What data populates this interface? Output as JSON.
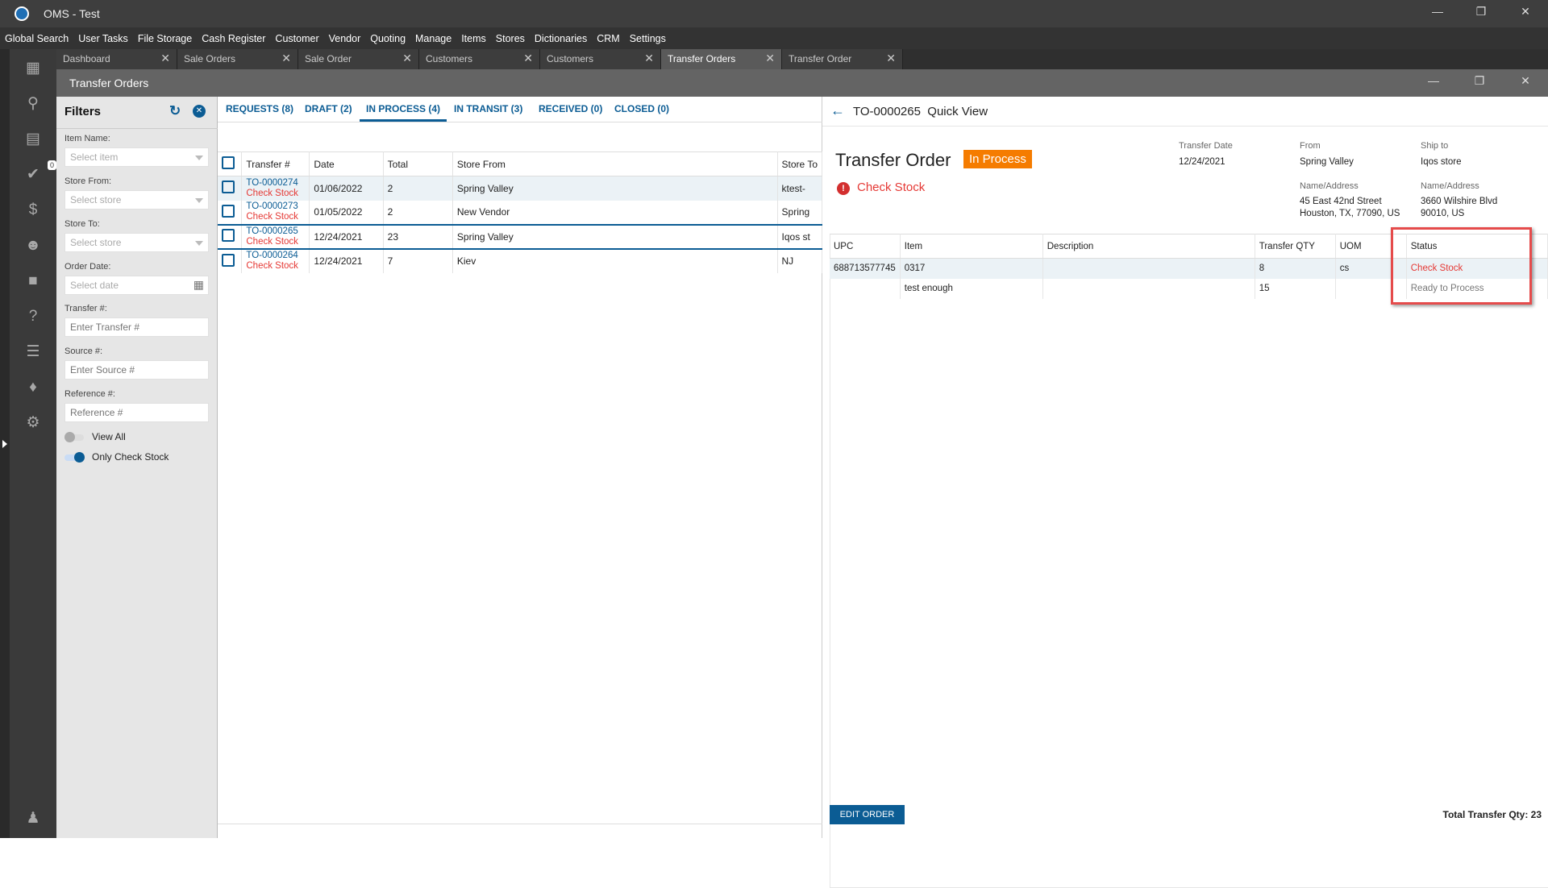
{
  "app": {
    "title": "OMS - Test"
  },
  "menu": [
    "Global Search",
    "User Tasks",
    "File Storage",
    "Cash Register",
    "Customer",
    "Vendor",
    "Quoting",
    "Manage",
    "Items",
    "Stores",
    "Dictionaries",
    "CRM",
    "Settings"
  ],
  "tabs": [
    {
      "label": "Dashboard"
    },
    {
      "label": "Sale Orders"
    },
    {
      "label": "Sale Order"
    },
    {
      "label": "Customers"
    },
    {
      "label": "Customers"
    },
    {
      "label": "Transfer Orders",
      "active": true
    },
    {
      "label": "Transfer Order"
    }
  ],
  "sidebar": {
    "tasks_badge": "0"
  },
  "window": {
    "title": "Transfer Orders"
  },
  "filters": {
    "title": "Filters",
    "item_name": {
      "label": "Item Name:",
      "placeholder": "Select item"
    },
    "store_from": {
      "label": "Store From:",
      "placeholder": "Select store"
    },
    "store_to": {
      "label": "Store To:",
      "placeholder": "Select store"
    },
    "order_date": {
      "label": "Order Date:",
      "placeholder": "Select date"
    },
    "transfer": {
      "label": "Transfer #:",
      "placeholder": "Enter Transfer #"
    },
    "source": {
      "label": "Source #:",
      "placeholder": "Enter Source #"
    },
    "reference": {
      "label": "Reference #:",
      "placeholder": "Reference #"
    },
    "view_all": {
      "label": "View All",
      "on": false
    },
    "only_check_stock": {
      "label": "Only Check Stock",
      "on": true
    }
  },
  "list": {
    "tabs": [
      "REQUESTS (8)",
      "DRAFT (2)",
      "IN PROCESS (4)",
      "IN TRANSIT (3)",
      "RECEIVED (0)",
      "CLOSED (0)"
    ],
    "active_tab": "IN PROCESS (4)",
    "columns": [
      "Transfer #",
      "Date",
      "Total",
      "Store From",
      "Store To"
    ],
    "rows": [
      {
        "number": "TO-0000274",
        "flag": "Check Stock",
        "date": "01/06/2022",
        "total": "2",
        "from": "Spring Valley",
        "to": "ktest-"
      },
      {
        "number": "TO-0000273",
        "flag": "Check Stock",
        "date": "01/05/2022",
        "total": "2",
        "from": "New Vendor",
        "to": "Spring"
      },
      {
        "number": "TO-0000265",
        "flag": "Check Stock",
        "date": "12/24/2021",
        "total": "23",
        "from": "Spring Valley",
        "to": "Iqos st"
      },
      {
        "number": "TO-0000264",
        "flag": "Check Stock",
        "date": "12/24/2021",
        "total": "7",
        "from": "Kiev",
        "to": "NJ"
      }
    ]
  },
  "quick_view": {
    "header": "TO-0000265  Quick View",
    "title": "Transfer Order",
    "status": "In Process",
    "status_color": "#f57c00",
    "warning": "Check Stock",
    "transfer_date_label": "Transfer Date",
    "transfer_date": "12/24/2021",
    "from_label": "From",
    "from": "Spring Valley",
    "ship_to_label": "Ship to",
    "ship_to": "Iqos store",
    "from_addr_label": "Name/Address",
    "from_addr_1": "45 East 42nd Street",
    "from_addr_2": "Houston, TX, 77090, US",
    "to_addr_label": "Name/Address",
    "to_addr_1": "3660 Wilshire Blvd",
    "to_addr_2": "90010, US",
    "columns": [
      "UPC",
      "Item",
      "Description",
      "Transfer QTY",
      "UOM",
      "Status"
    ],
    "rows": [
      {
        "upc": "688713577745",
        "item": "0317",
        "description": "",
        "qty": "8",
        "uom": "cs",
        "status": "Check Stock"
      },
      {
        "upc": "",
        "item": "test enough",
        "description": "",
        "qty": "15",
        "uom": "",
        "status": "Ready to Process"
      }
    ],
    "edit_label": "EDIT ORDER",
    "total_label": "Total Transfer Qty: 23"
  }
}
